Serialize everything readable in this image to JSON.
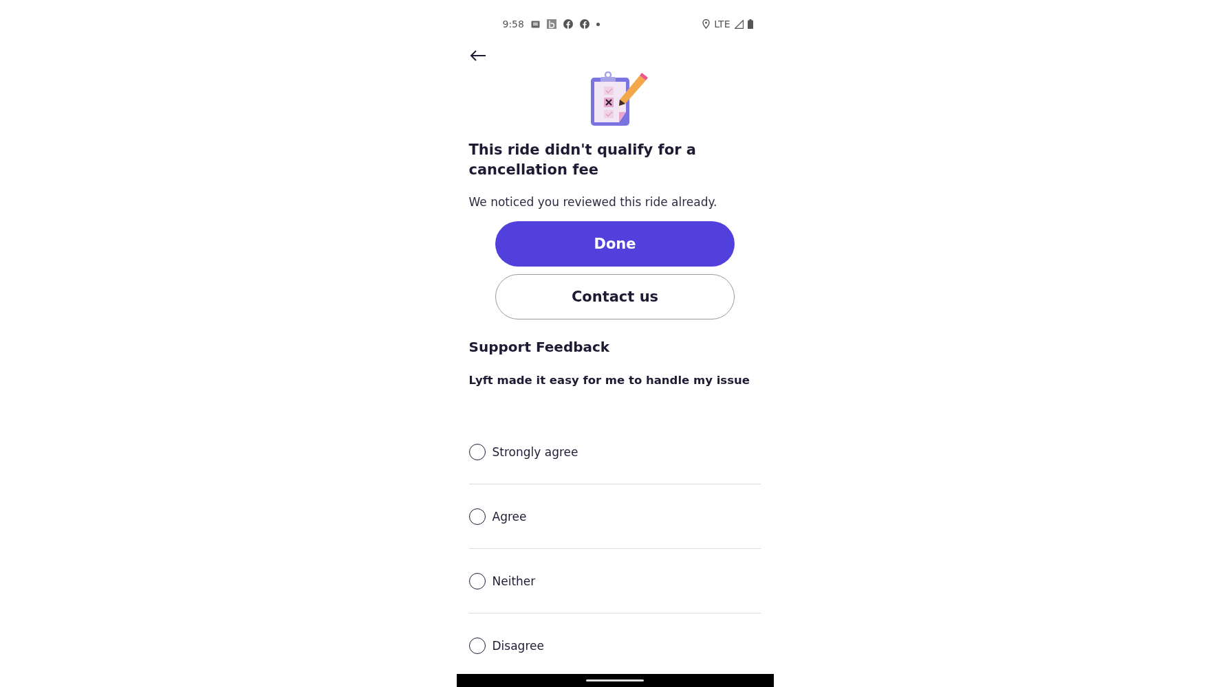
{
  "status_bar": {
    "time": "9:58",
    "network": "LTE"
  },
  "title": "This ride didn't qualify for a cancellation fee",
  "message": "We noticed you reviewed this ride already.",
  "buttons": [
    {
      "label": "Done",
      "kind": "primary"
    },
    {
      "label": "Contact us",
      "kind": "secondary"
    }
  ],
  "feedback": {
    "heading": "Support Feedback",
    "question": "Lyft made it easy for me to handle my issue",
    "options": [
      {
        "label": "Strongly agree",
        "selected": false
      },
      {
        "label": "Agree",
        "selected": false
      },
      {
        "label": "Neither",
        "selected": false
      },
      {
        "label": "Disagree",
        "selected": false
      }
    ]
  }
}
